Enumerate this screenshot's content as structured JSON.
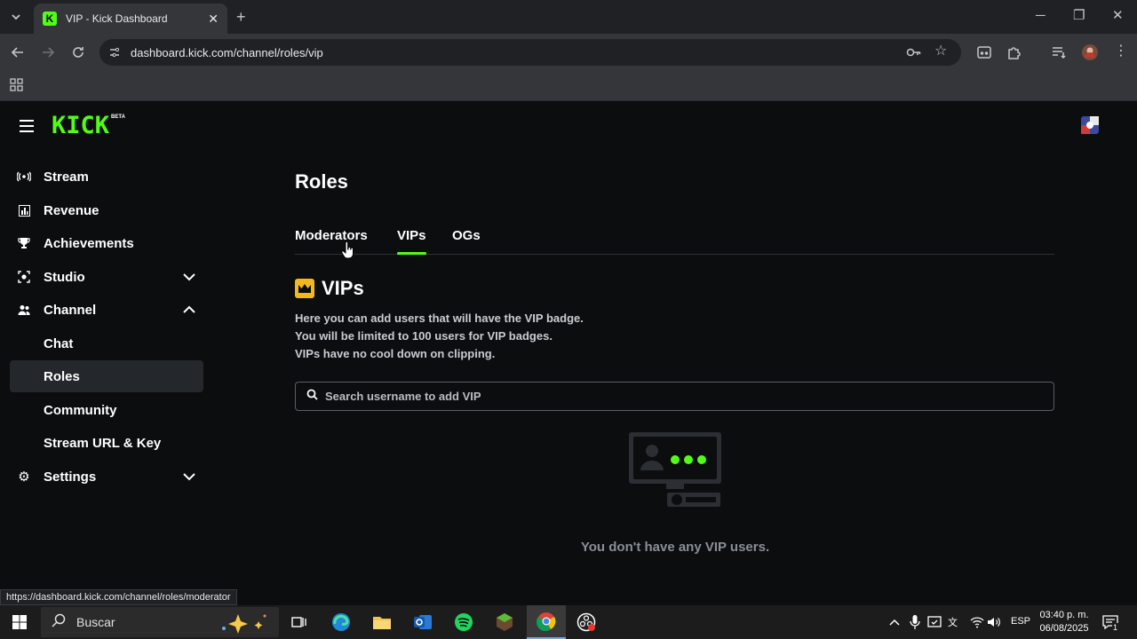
{
  "browser": {
    "tab_title": "VIP - Kick Dashboard",
    "url": "dashboard.kick.com/channel/roles/vip",
    "status_url": "https://dashboard.kick.com/channel/roles/moderator"
  },
  "brand": {
    "logo_text": "KICK",
    "logo_badge": "BETA",
    "accent": "#53fc18"
  },
  "sidebar": {
    "items": [
      {
        "label": "Stream",
        "icon": "broadcast-icon"
      },
      {
        "label": "Revenue",
        "icon": "bar-chart-icon"
      },
      {
        "label": "Achievements",
        "icon": "trophy-icon"
      },
      {
        "label": "Studio",
        "icon": "camera-icon",
        "expanded": false
      },
      {
        "label": "Channel",
        "icon": "users-icon",
        "expanded": true
      },
      {
        "label": "Settings",
        "icon": "gear-icon",
        "expanded": false
      }
    ],
    "channel_sub": [
      "Chat",
      "Roles",
      "Community",
      "Stream URL & Key"
    ],
    "active_sub": "Roles"
  },
  "main": {
    "title": "Roles",
    "tabs": [
      "Moderators",
      "VIPs",
      "OGs"
    ],
    "active_tab": "VIPs",
    "section_title": "VIPs",
    "description": [
      "Here you can add users that will have the VIP badge.",
      "You will be limited to 100 users for VIP badges.",
      "VIPs have no cool down on clipping."
    ],
    "search_placeholder": "Search username to add VIP",
    "empty_text": "You don't have any VIP users."
  },
  "taskbar": {
    "search_label": "Buscar",
    "language": "ESP",
    "time": "03:40 p. m.",
    "date": "06/08/2025",
    "notification_count": "1"
  }
}
